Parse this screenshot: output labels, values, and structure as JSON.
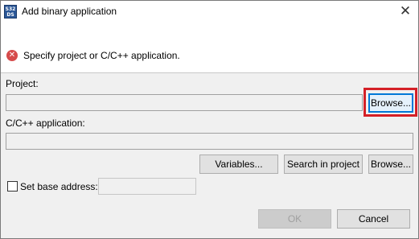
{
  "window": {
    "title": "Add binary application",
    "app_icon_text": "S32\nDS",
    "close_symbol": "✕"
  },
  "message": {
    "icon_symbol": "✕",
    "text": "Specify project or C/C++ application."
  },
  "project": {
    "label": "Project:",
    "value": "",
    "browse_label": "Browse..."
  },
  "application": {
    "label": "C/C++ application:",
    "value": "",
    "variables_label": "Variables...",
    "search_label": "Search in project",
    "browse_label": "Browse..."
  },
  "base_address": {
    "checkbox_label": "Set base address:",
    "checked": false,
    "value": ""
  },
  "footer": {
    "ok_label": "OK",
    "cancel_label": "Cancel"
  },
  "colors": {
    "highlight": "#d42027",
    "error": "#d64b4b",
    "focus": "#0078d7"
  }
}
